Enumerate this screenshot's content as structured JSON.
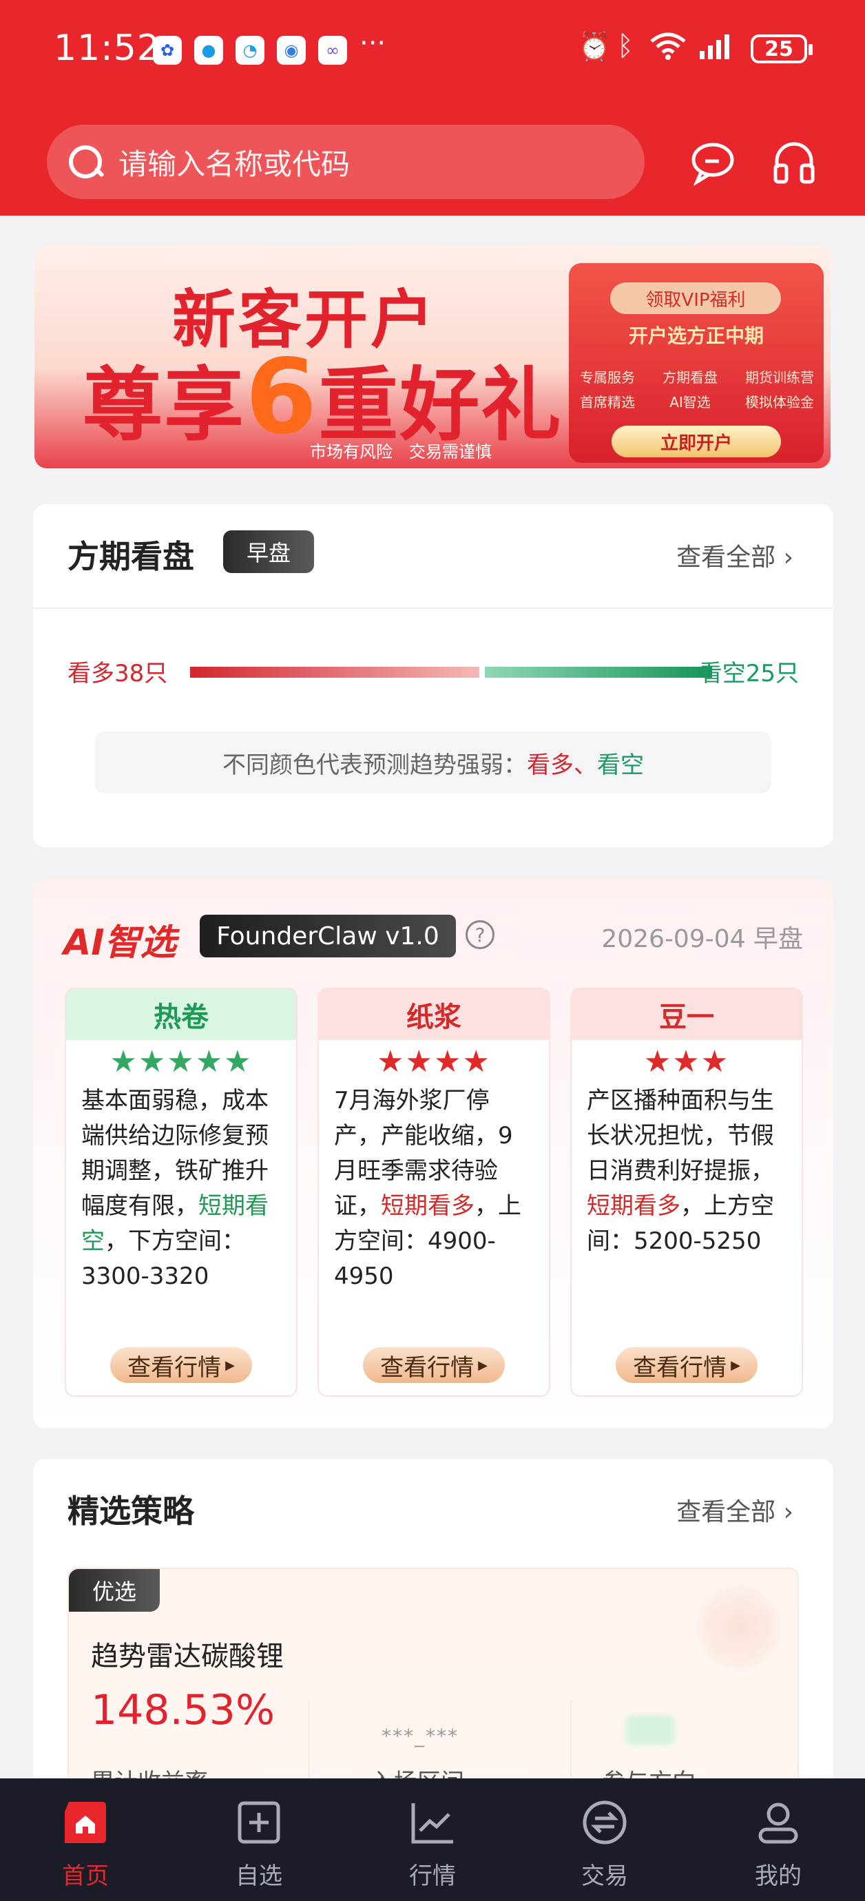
{
  "status": {
    "time": "11:52",
    "dots": "···",
    "battery": "25",
    "signal_label": "6"
  },
  "search": {
    "placeholder": "请输入名称或代码"
  },
  "header_icons": [
    "message-icon",
    "headset-icon"
  ],
  "banner": {
    "line1": "新客开户",
    "line2_a": "尊享",
    "line2_num": "6",
    "line2_b": "重好礼",
    "risk": "市场有风险　交易需谨慎",
    "vip": "领取VIP福利",
    "env_title": "开户选方正中期",
    "features_row1": [
      "专属服务",
      "方期看盘",
      "期货训练营"
    ],
    "features_row2": [
      "首席精选",
      "AI智选",
      "模拟体验金"
    ],
    "cta": "立即开户"
  },
  "market_view": {
    "title": "方期看盘",
    "badge": "早盘",
    "see_all": "查看全部",
    "bull": "看多38只",
    "bear": "看空25只",
    "hint_prefix": "不同颜色代表预测趋势强弱：",
    "hint_bull": "看多",
    "hint_sep": "、",
    "hint_bear": "看空",
    "bull_count": 38,
    "bear_count": 25
  },
  "ai_pick": {
    "logo": "AI智选",
    "version": "FounderClaw v1.0",
    "help": "?",
    "date": "2026-09-04 早盘",
    "items": [
      {
        "name": "热卷",
        "stars": "★★★★★",
        "text_a": "基本面弱稳，成本端供给边际修复预期调整，铁矿推升幅度有限，",
        "signal": "短期看空",
        "text_b": "，下方空间：3300-3320",
        "button": "查看行情"
      },
      {
        "name": "纸浆",
        "stars": "★★★★",
        "text_a": "7月海外浆厂停产，产能收缩，9月旺季需求待验证，",
        "signal": "短期看多",
        "text_b": "，上方空间：4900-4950",
        "button": "查看行情"
      },
      {
        "name": "豆一",
        "stars": "★★★",
        "text_a": "产区播种面积与生长状况担忧，节假日消费利好提振，",
        "signal": "短期看多",
        "text_b": "，上方空间：5200-5250",
        "button": "查看行情"
      }
    ]
  },
  "strategy": {
    "title": "精选策略",
    "see_all": "查看全部",
    "tag": "优选",
    "name": "趋势雷达碳酸锂",
    "return": "148.53%",
    "return_label": "累计收益率",
    "entry_masked": "***_***",
    "entry_label": "入场区间",
    "direction_label": "参与方向"
  },
  "tabbar": {
    "items": [
      {
        "label": "首页",
        "active": true
      },
      {
        "label": "自选",
        "active": false
      },
      {
        "label": "行情",
        "active": false
      },
      {
        "label": "交易",
        "active": false
      },
      {
        "label": "我的",
        "active": false
      }
    ]
  },
  "colors": {
    "brand_red": "#e8262b",
    "bull_red": "#d3262f",
    "bear_green": "#1c9a62",
    "tabbar_bg": "#1a1d27"
  }
}
